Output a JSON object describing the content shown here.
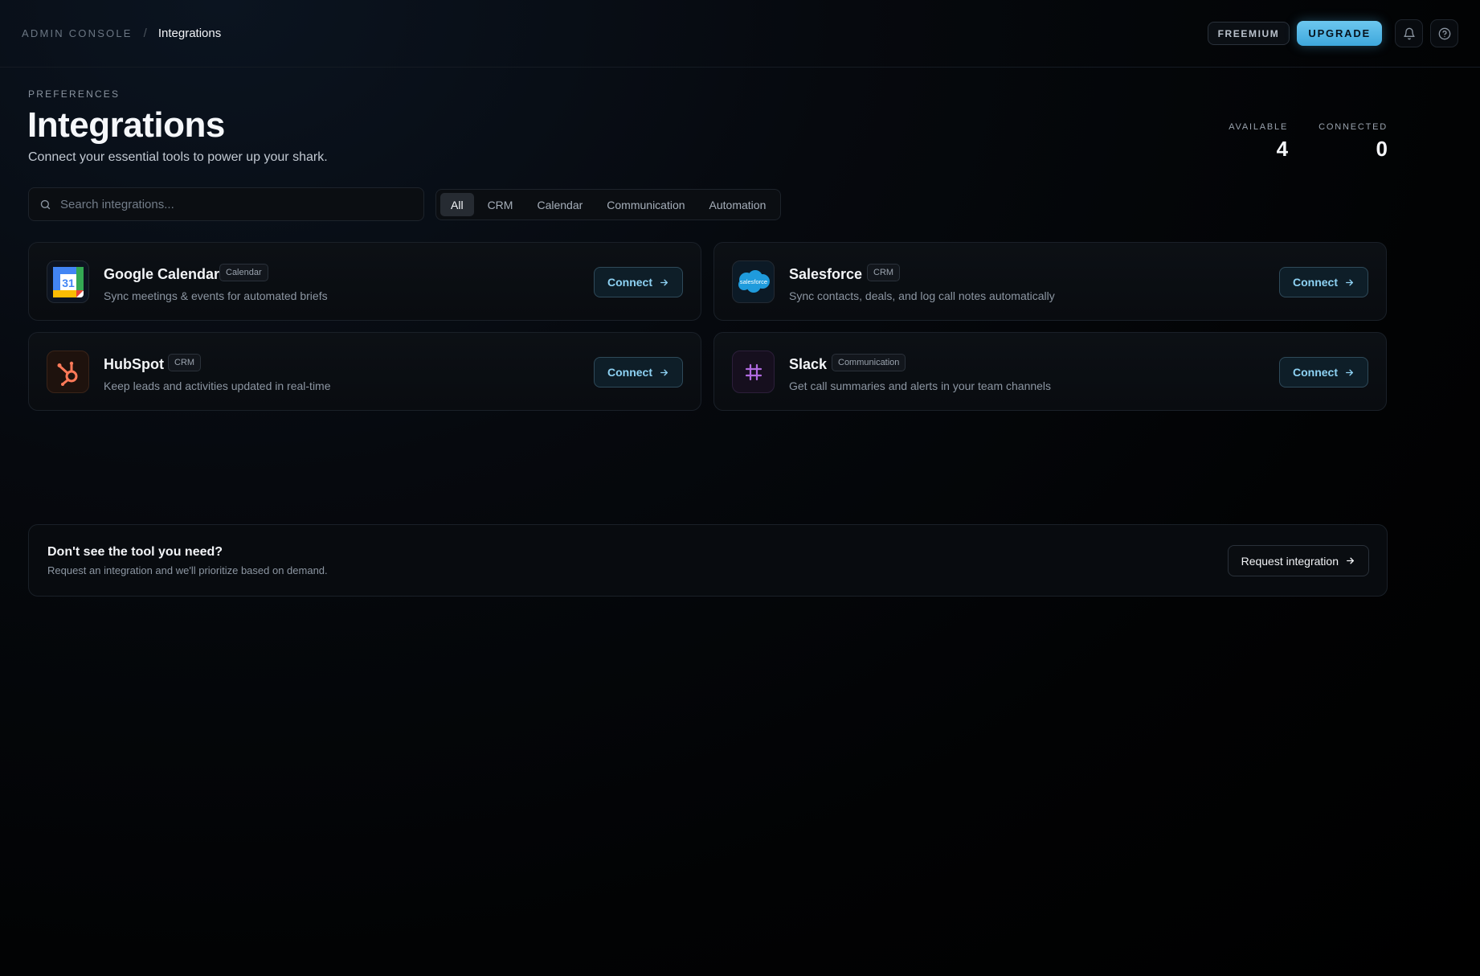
{
  "header": {
    "breadcrumb_root": "ADMIN CONSOLE",
    "breadcrumb_sep": "/",
    "breadcrumb_current": "Integrations",
    "plan_badge": "FREEMIUM",
    "upgrade_label": "UPGRADE",
    "icons": [
      "bell-icon",
      "help-circle-icon"
    ]
  },
  "page": {
    "eyebrow": "PREFERENCES",
    "title": "Integrations",
    "subtitle": "Connect your essential tools to power up your shark."
  },
  "stats": [
    {
      "label": "AVAILABLE",
      "value": "4"
    },
    {
      "label": "CONNECTED",
      "value": "0"
    }
  ],
  "search": {
    "placeholder": "Search integrations..."
  },
  "filters": [
    {
      "label": "All",
      "active": true
    },
    {
      "label": "CRM",
      "active": false
    },
    {
      "label": "Calendar",
      "active": false
    },
    {
      "label": "Communication",
      "active": false
    },
    {
      "label": "Automation",
      "active": false
    }
  ],
  "integrations": [
    {
      "name": "Google Calendar",
      "tag": "Calendar",
      "description": "Sync meetings & events for automated briefs",
      "action": "Connect",
      "icon": "google-calendar-icon",
      "calendar_day": "31"
    },
    {
      "name": "Salesforce",
      "tag": "CRM",
      "description": "Sync contacts, deals, and log call notes automatically",
      "action": "Connect",
      "icon": "salesforce-icon",
      "logo_text": "salesforce"
    },
    {
      "name": "HubSpot",
      "tag": "CRM",
      "description": "Keep leads and activities updated in real-time",
      "action": "Connect",
      "icon": "hubspot-icon"
    },
    {
      "name": "Slack",
      "tag": "Communication",
      "description": "Get call summaries and alerts in your team channels",
      "action": "Connect",
      "icon": "slack-icon"
    }
  ],
  "request": {
    "title": "Don't see the tool you need?",
    "subtitle": "Request an integration and we'll prioritize based on demand.",
    "action": "Request integration"
  },
  "colors": {
    "accent": "#4fb6e6",
    "background": "#05080c",
    "connect_text": "#8ed2f3",
    "hubspot": "#ff7a59",
    "slack": "#b06ae0",
    "salesforce": "#1f9bdc"
  }
}
